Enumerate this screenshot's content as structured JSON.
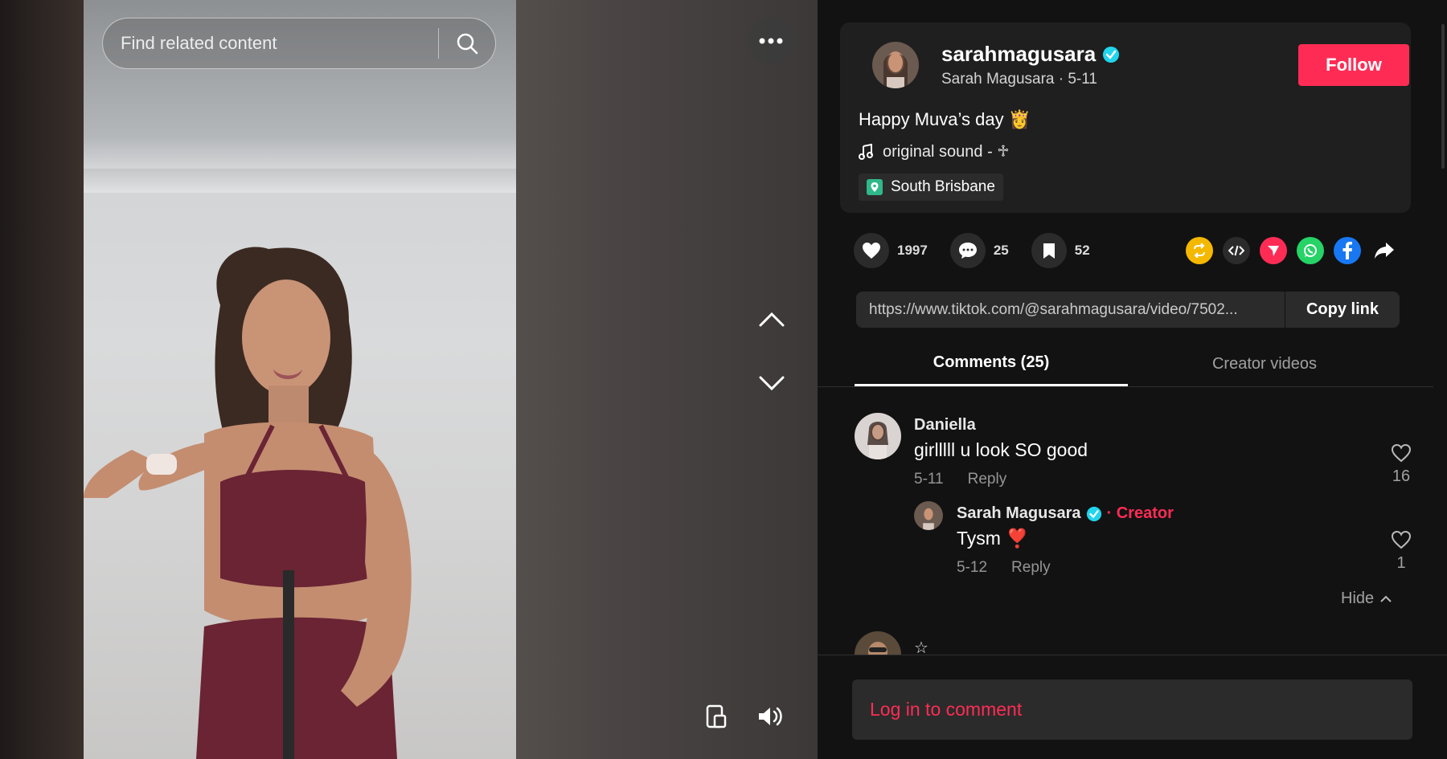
{
  "search": {
    "placeholder": "Find related content"
  },
  "author": {
    "handle": "sarahmagusara",
    "display_name": "Sarah Magusara",
    "date": "5-11",
    "sub_line": "Sarah Magusara · 5-11",
    "follow_label": "Follow"
  },
  "post": {
    "caption": "Happy Muva’s day 👸",
    "sound": "original sound - ♱",
    "location": "South Brisbane"
  },
  "stats": {
    "likes": "1997",
    "comments": "25",
    "saves": "52"
  },
  "share": {
    "link": "https://www.tiktok.com/@sarahmagusara/video/7502...",
    "copy_label": "Copy link",
    "icons": [
      "repost-icon",
      "embed-icon",
      "send-icon",
      "whatsapp-icon",
      "facebook-icon",
      "share-arrow-icon"
    ]
  },
  "tabs": {
    "comments": "Comments (25)",
    "creator_videos": "Creator videos"
  },
  "comments": [
    {
      "name": "Daniella",
      "text": "girlllll u look SO good",
      "date": "5-11",
      "reply_label": "Reply",
      "likes": "16",
      "replies": [
        {
          "name": "Sarah Magusara",
          "badge": "· Creator",
          "text": "Tysm ❣️",
          "date": "5-12",
          "reply_label": "Reply",
          "likes": "1"
        }
      ]
    },
    {
      "name": "",
      "text": "☆"
    }
  ],
  "hide_label": "Hide",
  "login_label": "Log in to comment",
  "colors": {
    "accent": "#fe2c55",
    "verified": "#20d5ec",
    "panel": "#121212",
    "card": "#1f1f1f"
  }
}
